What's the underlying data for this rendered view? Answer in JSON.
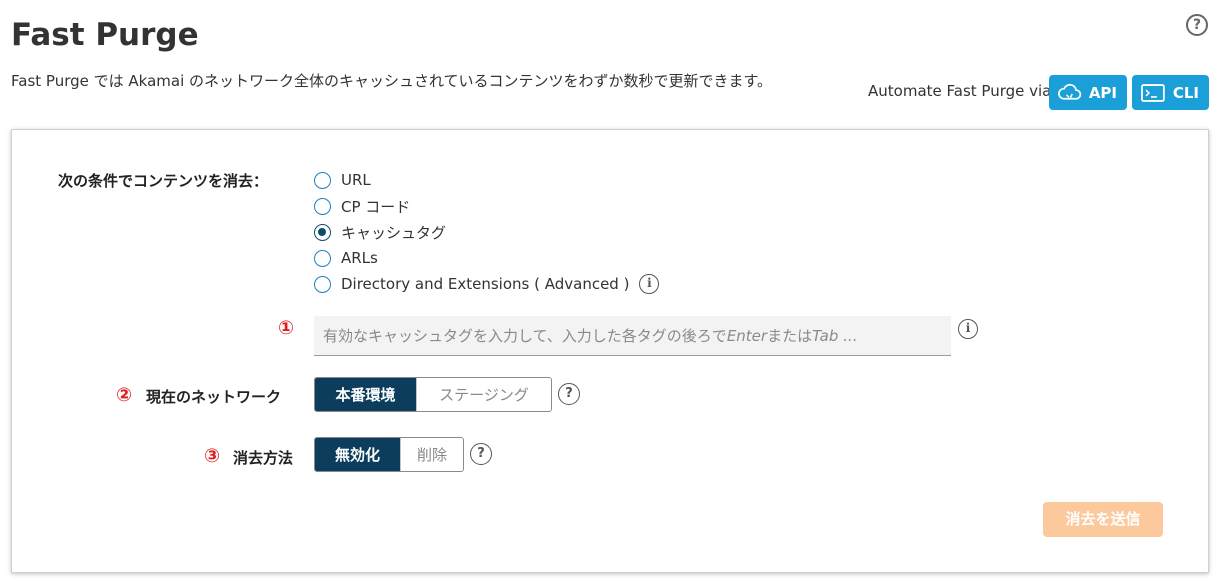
{
  "header": {
    "title": "Fast Purge",
    "description": "Fast Purge では Akamai のネットワーク全体のキャッシュされているコンテンツをわずか数秒で更新できます。",
    "help_label": "?",
    "automate_label": "Automate Fast Purge via",
    "api_label": "API",
    "cli_label": "CLI"
  },
  "form": {
    "purge_by_label": "次の条件でコンテンツを消去：",
    "options": [
      {
        "label": "URL",
        "checked": false
      },
      {
        "label": "CP コード",
        "checked": false
      },
      {
        "label": "キャッシュタグ",
        "checked": true
      },
      {
        "label": "ARLs",
        "checked": false
      },
      {
        "label": "Directory and Extensions ( Advanced )",
        "checked": false
      }
    ],
    "info_label": "i",
    "marker_1": "①",
    "marker_2": "②",
    "marker_3": "③",
    "input_placeholder_main": "有効なキャッシュタグを入力して、入力した各タグの後ろで ",
    "input_placeholder_enter": "Enter",
    "input_placeholder_or": " または ",
    "input_placeholder_tab": "Tab ...",
    "network_label": "現在のネットワーク",
    "network_options": [
      "本番環境",
      "ステージング"
    ],
    "network_selected": "本番環境",
    "method_label": "消去方法",
    "method_options": [
      "無効化",
      "削除"
    ],
    "method_selected": "無効化",
    "help_label": "?",
    "submit_label": "消去を送信"
  },
  "colors": {
    "accent_blue": "#1a9fd9",
    "navy": "#0d3d5c",
    "marker_red": "#e02020",
    "submit_disabled": "#fcc99d"
  }
}
